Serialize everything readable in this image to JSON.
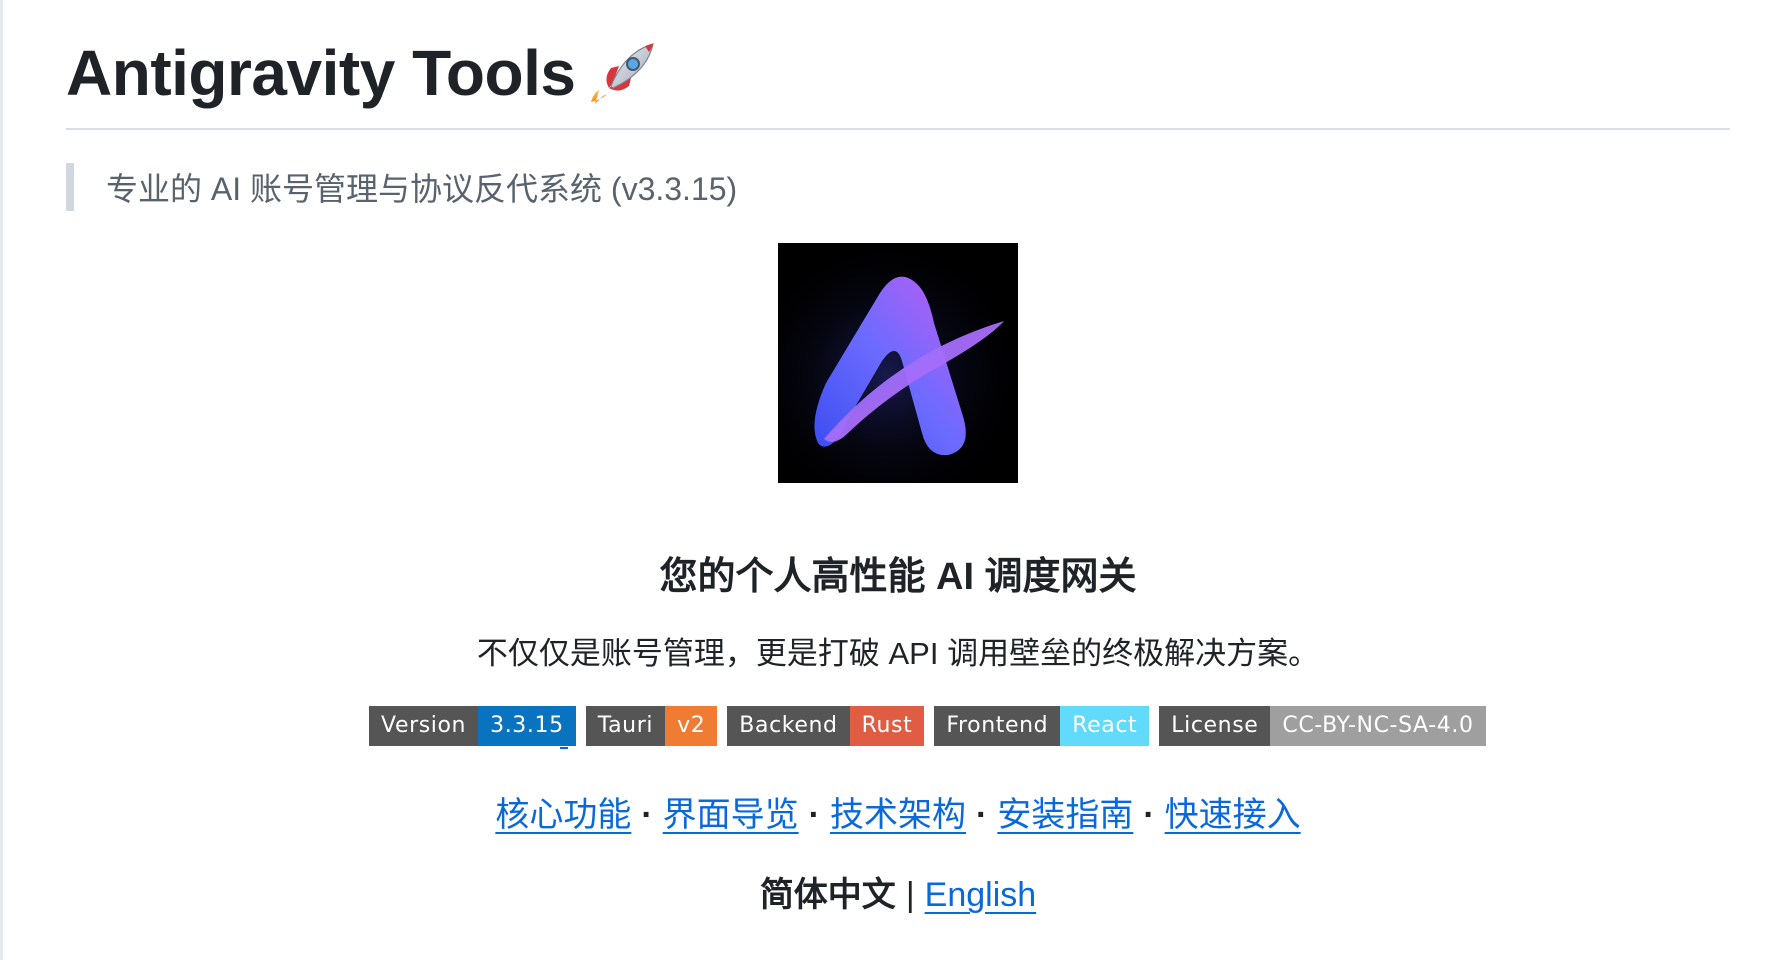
{
  "header": {
    "title": "Antigravity Tools",
    "title_icon": "rocket-icon"
  },
  "quote": {
    "text": "专业的 AI 账号管理与协议反代系统 (v3.3.15)"
  },
  "logo": {
    "icon": "antigravity-logo-icon"
  },
  "subtitle": "您的个人高性能 AI 调度网关",
  "tagline": "不仅仅是账号管理，更是打破 API 调用壁垒的终极解决方案。",
  "badges": [
    {
      "key": "Version",
      "value": "3.3.15",
      "color": "#0a73bf"
    },
    {
      "key": "Tauri",
      "value": "v2",
      "color": "#f07b33"
    },
    {
      "key": "Backend",
      "value": "Rust",
      "color": "#e05d44"
    },
    {
      "key": "Frontend",
      "value": "React",
      "color": "#61dafb"
    },
    {
      "key": "License",
      "value": "CC-BY-NC-SA-4.0",
      "color": "#9f9f9f"
    }
  ],
  "nav": {
    "links": [
      "核心功能",
      "界面导览",
      "技术架构",
      "安装指南",
      "快速接入"
    ],
    "separator": "·"
  },
  "language": {
    "current": "简体中文",
    "separator": "|",
    "other": "English"
  },
  "colors": {
    "link": "#0969da",
    "text": "#1f2328",
    "muted": "#59636e"
  }
}
